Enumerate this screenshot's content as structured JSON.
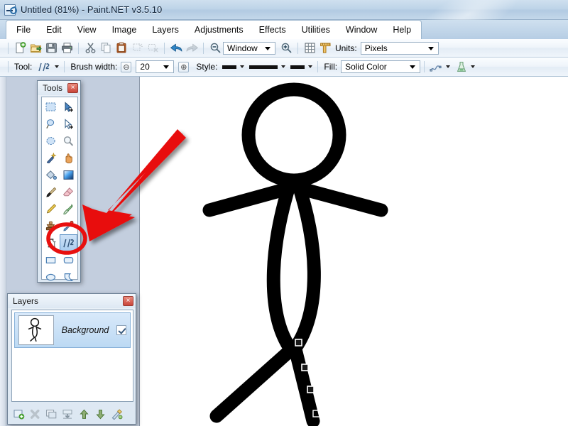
{
  "window": {
    "title": "Untitled (81%) - Paint.NET v3.5.10",
    "document_name": "Untitled",
    "zoom_percent": "81%",
    "app_name": "Paint.NET",
    "app_version": "v3.5.10",
    "icon": "paintdotnet-app-icon"
  },
  "menu": {
    "items": [
      {
        "label": "File"
      },
      {
        "label": "Edit"
      },
      {
        "label": "View"
      },
      {
        "label": "Image"
      },
      {
        "label": "Layers"
      },
      {
        "label": "Adjustments"
      },
      {
        "label": "Effects"
      },
      {
        "label": "Utilities"
      },
      {
        "label": "Window"
      },
      {
        "label": "Help"
      }
    ]
  },
  "toolbar_main": {
    "buttons": [
      {
        "name": "new-icon",
        "tip": "New"
      },
      {
        "name": "open-icon",
        "tip": "Open"
      },
      {
        "name": "save-icon",
        "tip": "Save"
      },
      {
        "name": "print-icon",
        "tip": "Print"
      },
      {
        "name": "cut-icon",
        "tip": "Cut"
      },
      {
        "name": "copy-icon",
        "tip": "Copy"
      },
      {
        "name": "paste-icon",
        "tip": "Paste"
      },
      {
        "name": "crop-to-selection-icon",
        "tip": "Crop to Selection"
      },
      {
        "name": "deselect-all-icon",
        "tip": "Deselect All"
      },
      {
        "name": "undo-icon",
        "tip": "Undo"
      },
      {
        "name": "redo-icon",
        "tip": "Redo"
      },
      {
        "name": "zoom-out-icon",
        "tip": "Zoom Out"
      },
      {
        "name": "zoom-in-icon",
        "tip": "Zoom In"
      },
      {
        "name": "grid-icon",
        "tip": "Show Grid"
      },
      {
        "name": "rulers-icon",
        "tip": "Show Rulers"
      }
    ],
    "zoom_value": "Window",
    "units_label": "Units:",
    "units_value": "Pixels"
  },
  "toolbar_tool": {
    "tool_label": "Tool:",
    "tool_value": "Line/Curve",
    "brush_width_label": "Brush width:",
    "brush_width_value": "20",
    "decrease_label": "⊖",
    "increase_label": "⊕",
    "style_label": "Style:",
    "style_cap_start": "flat-cap-style",
    "style_dash": "solid-dash-style",
    "style_cap_end": "flat-cap-style",
    "fill_label": "Fill:",
    "fill_value": "Solid Color",
    "curve_type": "bezier-curve-icon",
    "antialias": "antialiasing-icon"
  },
  "tools_palette": {
    "title": "Tools",
    "close_label": "×",
    "tools": [
      {
        "name": "rectangle-select-tool",
        "label": "Rectangle Select",
        "selected": false
      },
      {
        "name": "move-selected-tool",
        "label": "Move Selected",
        "selected": false
      },
      {
        "name": "lasso-select-tool",
        "label": "Lasso Select",
        "selected": false
      },
      {
        "name": "move-selection-tool",
        "label": "Move Selection",
        "selected": false
      },
      {
        "name": "ellipse-select-tool",
        "label": "Ellipse Select",
        "selected": false
      },
      {
        "name": "zoom-tool",
        "label": "Zoom",
        "selected": false
      },
      {
        "name": "magic-wand-tool",
        "label": "Magic Wand",
        "selected": false
      },
      {
        "name": "pan-tool",
        "label": "Pan",
        "selected": false
      },
      {
        "name": "paint-bucket-tool",
        "label": "Paint Bucket",
        "selected": false
      },
      {
        "name": "gradient-tool",
        "label": "Gradient",
        "selected": false
      },
      {
        "name": "paintbrush-tool",
        "label": "Paintbrush",
        "selected": false
      },
      {
        "name": "eraser-tool",
        "label": "Eraser",
        "selected": false
      },
      {
        "name": "pencil-tool",
        "label": "Pencil",
        "selected": false
      },
      {
        "name": "color-picker-tool",
        "label": "Color Picker",
        "selected": false
      },
      {
        "name": "clone-stamp-tool",
        "label": "Clone Stamp",
        "selected": false
      },
      {
        "name": "recolor-tool",
        "label": "Recolor",
        "selected": false
      },
      {
        "name": "text-tool",
        "label": "Text",
        "selected": false
      },
      {
        "name": "line-curve-tool",
        "label": "Line / Curve",
        "selected": true
      },
      {
        "name": "rectangle-shape-tool",
        "label": "Rectangle",
        "selected": false
      },
      {
        "name": "rounded-rectangle-shape-tool",
        "label": "Rounded Rectangle",
        "selected": false
      },
      {
        "name": "ellipse-shape-tool",
        "label": "Ellipse",
        "selected": false
      },
      {
        "name": "freeform-shape-tool",
        "label": "Freeform Shape",
        "selected": false
      }
    ]
  },
  "layers_palette": {
    "title": "Layers",
    "close_label": "×",
    "layers": [
      {
        "name": "Background",
        "visible": true,
        "thumbnail": "stick-figure-thumbnail"
      }
    ],
    "buttons": [
      {
        "name": "add-new-layer-button",
        "label": "Add New Layer"
      },
      {
        "name": "delete-layer-button",
        "label": "Delete Layer"
      },
      {
        "name": "duplicate-layer-button",
        "label": "Duplicate Layer"
      },
      {
        "name": "merge-layer-down-button",
        "label": "Merge Layer Down"
      },
      {
        "name": "move-layer-up-button",
        "label": "Move Layer Up"
      },
      {
        "name": "move-layer-down-button",
        "label": "Move Layer Down"
      },
      {
        "name": "layer-properties-button",
        "label": "Properties"
      }
    ]
  },
  "canvas": {
    "drawing": "stick-figure-drawing",
    "stroke_color": "#000000",
    "background_color": "#ffffff",
    "active_handles": 4
  },
  "annotations": {
    "arrow": {
      "name": "red-arrow-annotation",
      "color": "#e8100f",
      "direction": "down-left"
    },
    "circle": {
      "name": "red-circle-annotation",
      "color": "#e8100f",
      "target": "line-curve-tool"
    }
  },
  "colors": {
    "title_bar": "#bed4e8",
    "workspace": "#c3cede",
    "annotation_red": "#e8100f",
    "selection_blue": "#a9cdef"
  }
}
